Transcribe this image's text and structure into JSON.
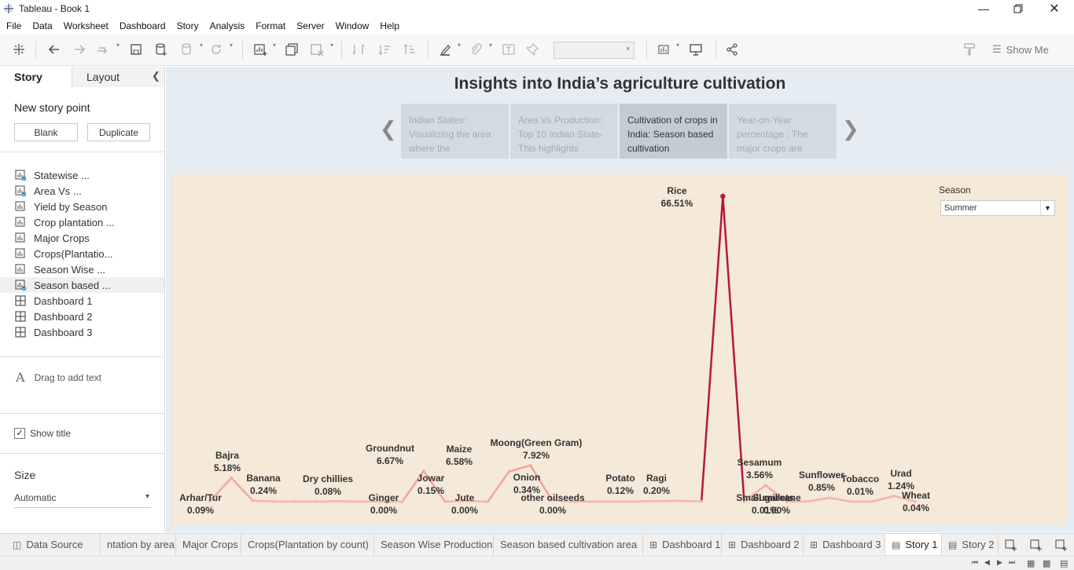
{
  "window": {
    "title": "Tableau - Book 1"
  },
  "menu": [
    "File",
    "Data",
    "Worksheet",
    "Dashboard",
    "Story",
    "Analysis",
    "Format",
    "Server",
    "Window",
    "Help"
  ],
  "toolbar": {
    "show_me": "Show Me"
  },
  "left_pane": {
    "tabs": {
      "story": "Story",
      "layout": "Layout"
    },
    "new_story_point": "New story point",
    "buttons": {
      "blank": "Blank",
      "duplicate": "Duplicate"
    },
    "sheets": [
      {
        "label": "Statewise ...",
        "type": "worksheet",
        "used": true
      },
      {
        "label": "Area Vs ...",
        "type": "worksheet",
        "used": true
      },
      {
        "label": "Yield by Season",
        "type": "worksheet",
        "used": false
      },
      {
        "label": "Crop plantation ...",
        "type": "worksheet",
        "used": false
      },
      {
        "label": "Major Crops",
        "type": "worksheet",
        "used": false
      },
      {
        "label": "Crops(Plantatio...",
        "type": "worksheet",
        "used": false
      },
      {
        "label": "Season Wise ...",
        "type": "worksheet",
        "used": false
      },
      {
        "label": "Season based ...",
        "type": "worksheet",
        "used": true
      },
      {
        "label": "Dashboard 1",
        "type": "dashboard",
        "used": false
      },
      {
        "label": "Dashboard 2",
        "type": "dashboard",
        "used": false
      },
      {
        "label": "Dashboard 3",
        "type": "dashboard",
        "used": false
      }
    ],
    "drag_text": "Drag to add text",
    "show_title": "Show title",
    "size_label": "Size",
    "size_value": "Automatic"
  },
  "story": {
    "title": "Insights into India’s agriculture cultivation",
    "captions": [
      {
        "text": "Indian States: Visualizing the area where the",
        "active": false
      },
      {
        "text": "Area Vs Production: Top 10 Indian State- This highlights",
        "active": false
      },
      {
        "text": "Cultivation of crops in India: Season based cultivation",
        "active": true
      },
      {
        "text": "Year-on-Year percentage : The major crops are",
        "active": false
      }
    ]
  },
  "filter": {
    "label": "Season",
    "value": "Summer"
  },
  "chart_data": {
    "type": "line",
    "title": "",
    "xlabel": "",
    "ylabel": "",
    "ylim": [
      0,
      70
    ],
    "series": [
      {
        "values_unit": "%",
        "points": [
          {
            "name": "Arhar/Tur",
            "value": 0.09,
            "label": "0.09%"
          },
          {
            "name": "Bajra",
            "value": 5.18,
            "label": "5.18%"
          },
          {
            "name": "Banana",
            "value": 0.24,
            "label": "0.24%"
          },
          {
            "name": "",
            "value": 0.05,
            "label": ""
          },
          {
            "name": "",
            "value": 0.05,
            "label": ""
          },
          {
            "name": "",
            "value": 0.05,
            "label": ""
          },
          {
            "name": "Dry chillies",
            "value": 0.08,
            "label": "0.08%"
          },
          {
            "name": "",
            "value": 0.05,
            "label": ""
          },
          {
            "name": "",
            "value": 0.05,
            "label": ""
          },
          {
            "name": "Ginger",
            "value": 0.0,
            "label": "0.00%"
          },
          {
            "name": "Groundnut",
            "value": 6.67,
            "label": "6.67%"
          },
          {
            "name": "",
            "value": 0.05,
            "label": ""
          },
          {
            "name": "Jowar",
            "value": 0.15,
            "label": "0.15%"
          },
          {
            "name": "Jute",
            "value": 0.0,
            "label": "0.00%"
          },
          {
            "name": "Maize",
            "value": 6.58,
            "label": "6.58%"
          },
          {
            "name": "Moong(Green Gram)",
            "value": 7.92,
            "label": "7.92%"
          },
          {
            "name": "Onion",
            "value": 0.34,
            "label": "0.34%"
          },
          {
            "name": "other oilseeds",
            "value": 0.0,
            "label": "0.00%"
          },
          {
            "name": "",
            "value": 0.05,
            "label": ""
          },
          {
            "name": "",
            "value": 0.05,
            "label": ""
          },
          {
            "name": "",
            "value": 0.05,
            "label": ""
          },
          {
            "name": "Potato",
            "value": 0.12,
            "label": "0.12%"
          },
          {
            "name": "Ragi",
            "value": 0.2,
            "label": "0.20%"
          },
          {
            "name": "",
            "value": 0.05,
            "label": ""
          },
          {
            "name": "Rice",
            "value": 66.51,
            "label": "66.51%"
          },
          {
            "name": "Small millets",
            "value": 0.01,
            "label": "0.01%"
          },
          {
            "name": "Sesamum",
            "value": 3.56,
            "label": "3.56%"
          },
          {
            "name": "Sugarcane",
            "value": 0.0,
            "label": "0.00%"
          },
          {
            "name": "",
            "value": 0.05,
            "label": ""
          },
          {
            "name": "Sunflower",
            "value": 0.85,
            "label": "0.85%"
          },
          {
            "name": "Tobacco",
            "value": 0.01,
            "label": "0.01%"
          },
          {
            "name": "",
            "value": 0.05,
            "label": ""
          },
          {
            "name": "Urad",
            "value": 1.24,
            "label": "1.24%"
          },
          {
            "name": "Wheat",
            "value": 0.04,
            "label": "0.04%"
          }
        ]
      }
    ],
    "colors": {
      "low": "#f6b5ab",
      "high": "#b8173d"
    },
    "legend": "none",
    "grid": false
  },
  "sheet_tabs": [
    {
      "label": "Data Source",
      "icon": "database-icon",
      "active": false
    },
    {
      "label": "ntation by area",
      "icon": "",
      "active": false
    },
    {
      "label": "Major Crops",
      "icon": "",
      "active": false
    },
    {
      "label": "Crops(Plantation by count)",
      "icon": "",
      "active": false
    },
    {
      "label": "Season Wise Production",
      "icon": "",
      "active": false
    },
    {
      "label": "Season based cultivation area",
      "icon": "",
      "active": false
    },
    {
      "label": "Dashboard 1",
      "icon": "dashboard-icon",
      "active": false
    },
    {
      "label": "Dashboard 2",
      "icon": "dashboard-icon",
      "active": false
    },
    {
      "label": "Dashboard 3",
      "icon": "dashboard-icon",
      "active": false
    },
    {
      "label": "Story 1",
      "icon": "story-icon",
      "active": true
    },
    {
      "label": "Story 2",
      "icon": "story-icon",
      "active": false
    }
  ]
}
